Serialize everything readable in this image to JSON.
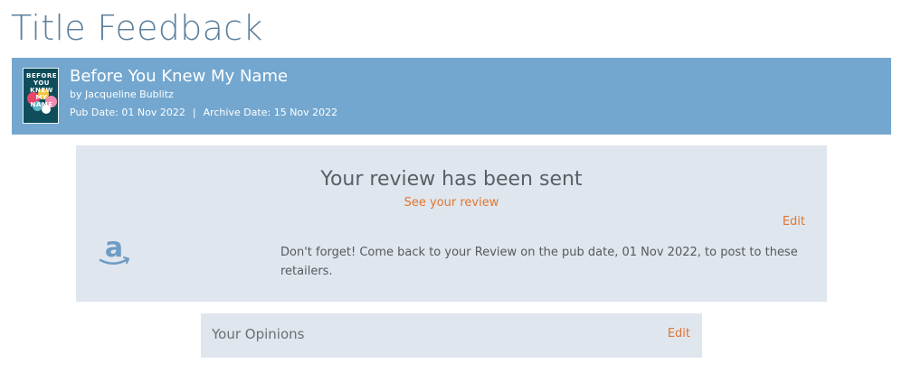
{
  "page": {
    "title": "Title Feedback"
  },
  "book": {
    "cover_text": "BEFORE YOU KNEW MY NAME",
    "title": "Before You Knew My Name",
    "author": "by Jacqueline Bublitz",
    "pub_date": "Pub Date: 01 Nov 2022",
    "separator": "|",
    "archive_date": "Archive Date: 15 Nov 2022"
  },
  "review": {
    "heading": "Your review has been sent",
    "see_review_link": "See your review",
    "edit_label": "Edit",
    "retailer_icon": "amazon-icon",
    "reminder": "Don't forget! Come back to your Review on the pub date, 01 Nov 2022, to post to these retailers."
  },
  "opinions": {
    "label": "Your Opinions",
    "edit_label": "Edit"
  },
  "colors": {
    "title": "#5b7f9c",
    "banner": "#73a7cf",
    "panel": "#e0e6ee",
    "link": "#e0762f",
    "amazon_icon": "#6e9cc4"
  }
}
